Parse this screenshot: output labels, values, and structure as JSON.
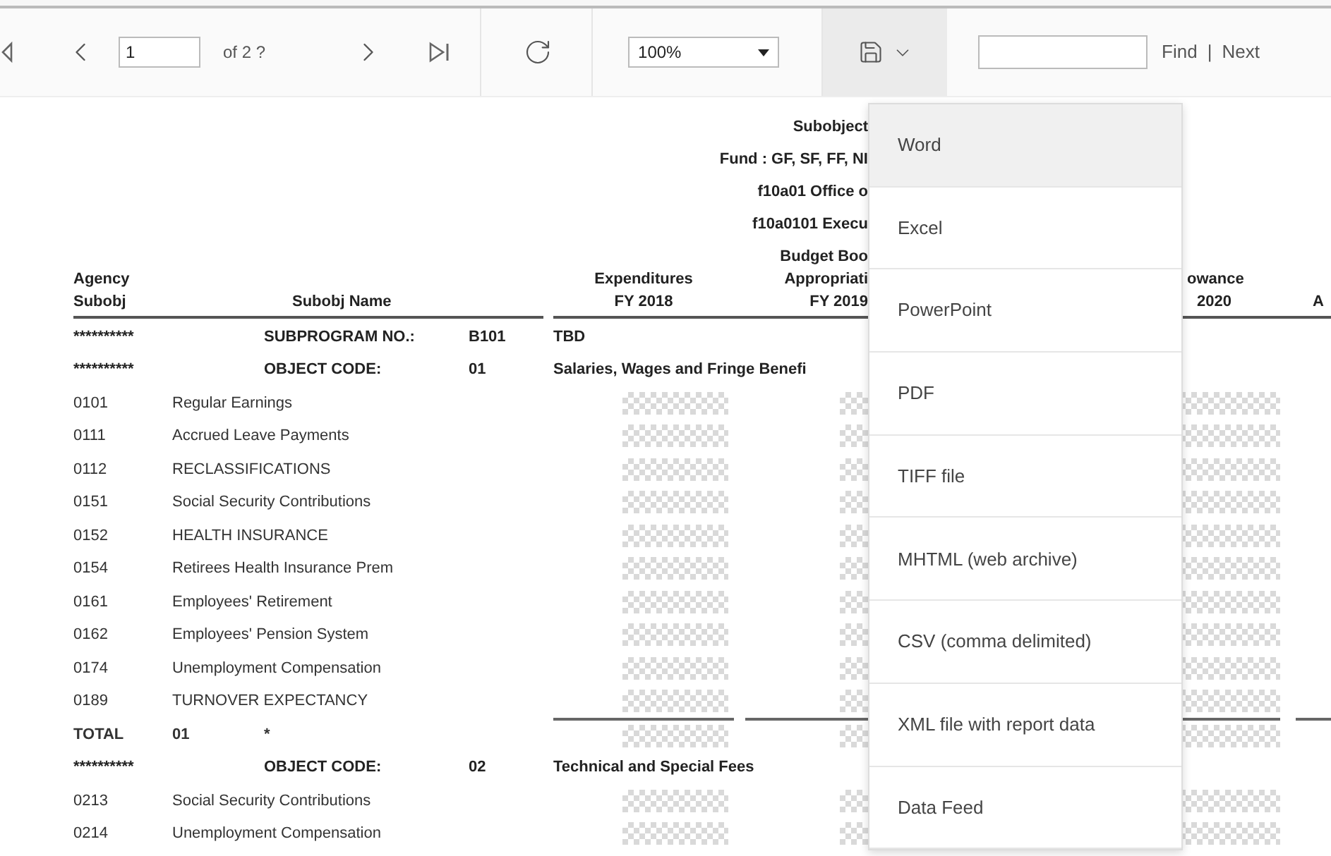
{
  "toolbar": {
    "page_value": "1",
    "page_count": "of 2 ?",
    "zoom_value": "100%",
    "export_open": true,
    "find_label": "Find",
    "find_separator": "|",
    "next_label": "Next"
  },
  "report": {
    "title_lines": [
      "Subobject",
      "Fund : GF, SF, FF, NI",
      "f10a01 Office o",
      "f10a0101 Execu",
      "Budget Boo"
    ],
    "columns": {
      "agency": [
        "Agency",
        "Subobj"
      ],
      "name": "Subobj Name",
      "expenditures": [
        "Expenditures",
        "FY 2018"
      ],
      "appropriation": [
        "Appropriati",
        "FY 2019"
      ],
      "allowance": [
        "owance",
        "2020"
      ],
      "column_last": "A"
    },
    "rows": [
      {
        "kind": "marker",
        "stars": "**********",
        "label": "SUBPROGRAM NO.:",
        "code": "B101",
        "description": "TBD"
      },
      {
        "kind": "marker",
        "stars": "**********",
        "label": "OBJECT CODE:",
        "code": "01",
        "description": "Salaries, Wages and Fringe Benefi"
      },
      {
        "kind": "item",
        "code": "0101",
        "name": "Regular Earnings"
      },
      {
        "kind": "item",
        "code": "0111",
        "name": "Accrued Leave Payments"
      },
      {
        "kind": "item",
        "code": "0112",
        "name": "RECLASSIFICATIONS"
      },
      {
        "kind": "item",
        "code": "0151",
        "name": "Social Security Contributions"
      },
      {
        "kind": "item",
        "code": "0152",
        "name": "HEALTH INSURANCE"
      },
      {
        "kind": "item",
        "code": "0154",
        "name": "Retirees Health Insurance Prem"
      },
      {
        "kind": "item",
        "code": "0161",
        "name": "Employees' Retirement"
      },
      {
        "kind": "item",
        "code": "0162",
        "name": "Employees' Pension System"
      },
      {
        "kind": "item",
        "code": "0174",
        "name": "Unemployment Compensation"
      },
      {
        "kind": "item",
        "code": "0189",
        "name": "TURNOVER EXPECTANCY"
      },
      {
        "kind": "total",
        "label": "TOTAL",
        "code": "01",
        "mark": "*"
      },
      {
        "kind": "marker",
        "stars": "**********",
        "label": "OBJECT CODE:",
        "code": "02",
        "description": "Technical and Special Fees"
      },
      {
        "kind": "item",
        "code": "0213",
        "name": "Social Security Contributions"
      },
      {
        "kind": "item",
        "code": "0214",
        "name": "Unemployment Compensation"
      }
    ]
  },
  "export_menu": [
    {
      "label": "Word",
      "selected": true
    },
    {
      "label": "Excel",
      "selected": false
    },
    {
      "label": "PowerPoint",
      "selected": false
    },
    {
      "label": "PDF",
      "selected": false
    },
    {
      "label": "TIFF file",
      "selected": false
    },
    {
      "label": "MHTML (web archive)",
      "selected": false
    },
    {
      "label": "CSV (comma delimited)",
      "selected": false
    },
    {
      "label": "XML file with report data",
      "selected": false
    },
    {
      "label": "Data Feed",
      "selected": false
    }
  ]
}
